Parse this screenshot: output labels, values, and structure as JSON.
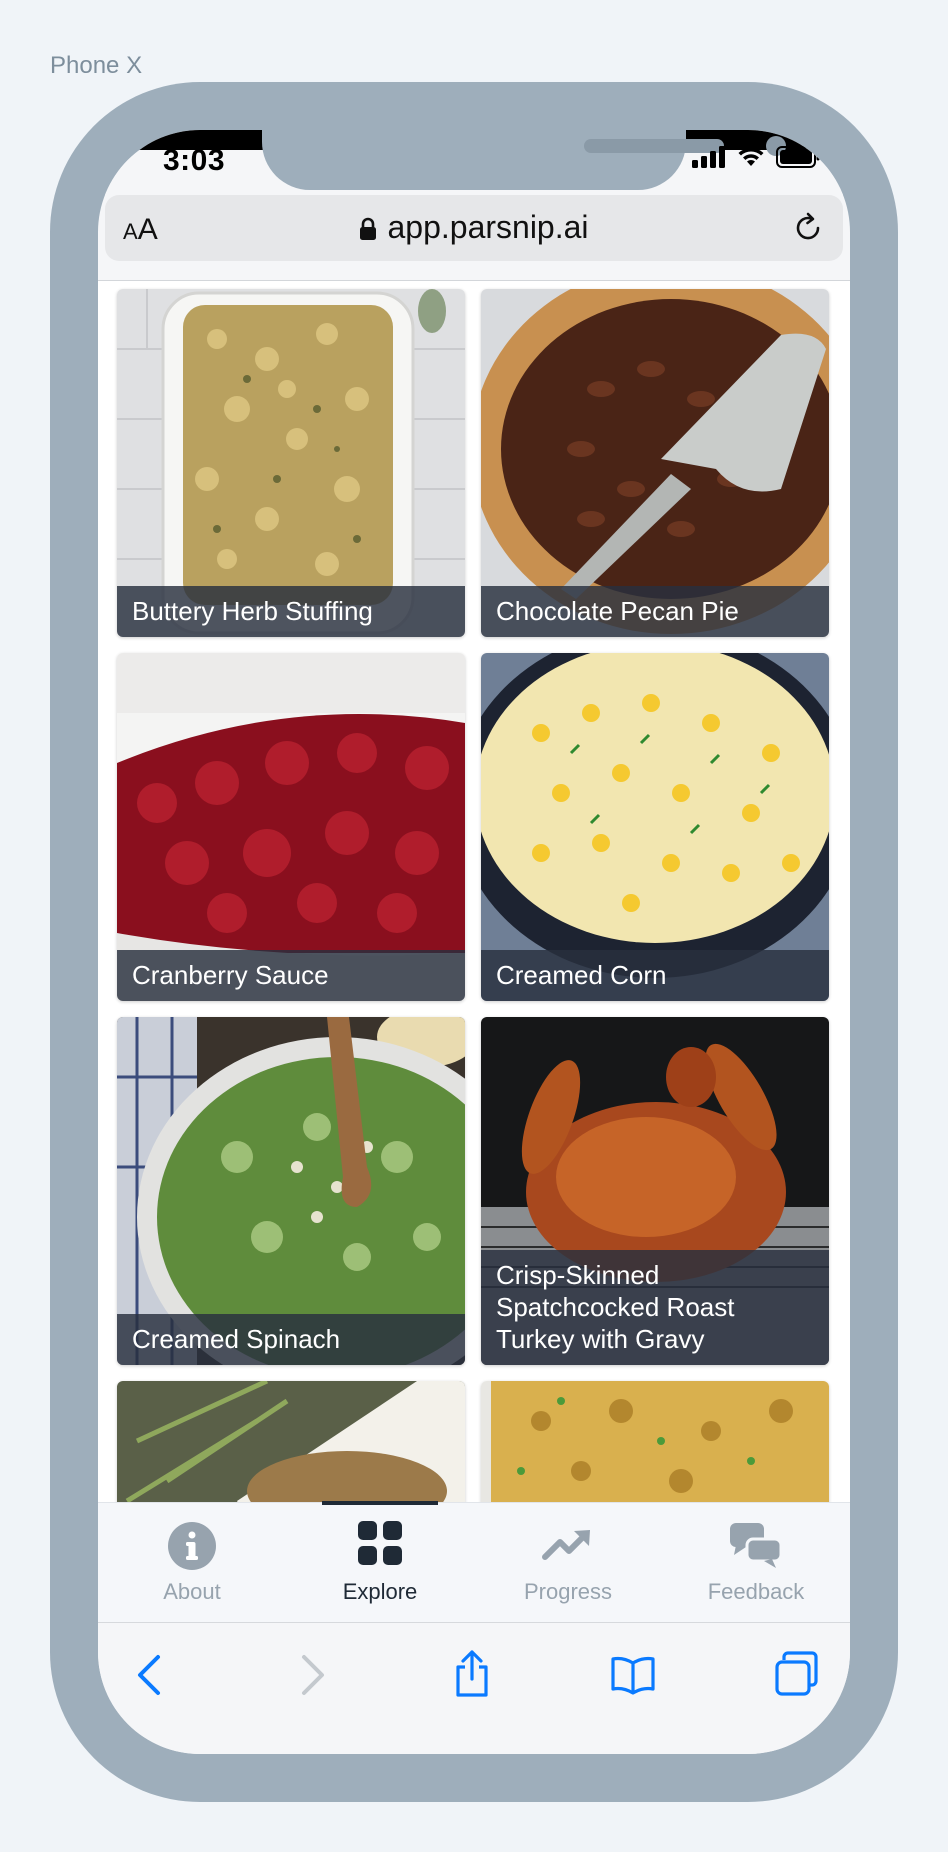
{
  "device_label": "Phone X",
  "status": {
    "time": "3:03"
  },
  "browser": {
    "url": "app.parsnip.ai",
    "text_size_button": "AA"
  },
  "recipes": [
    {
      "name": "Buttery Herb Stuffing"
    },
    {
      "name": "Chocolate Pecan Pie"
    },
    {
      "name": "Cranberry Sauce"
    },
    {
      "name": "Creamed Corn"
    },
    {
      "name": "Creamed Spinach"
    },
    {
      "name": "Crisp-Skinned Spatchcocked Roast Turkey with Gravy"
    },
    {
      "name": ""
    },
    {
      "name": ""
    }
  ],
  "tabs": [
    {
      "label": "About",
      "icon": "info-circle-icon"
    },
    {
      "label": "Explore",
      "icon": "grid-icon",
      "active": true
    },
    {
      "label": "Progress",
      "icon": "trending-up-icon"
    },
    {
      "label": "Feedback",
      "icon": "chat-bubbles-icon"
    }
  ],
  "colors": {
    "accent": "#0a7aff",
    "tab_active": "#1f2a36",
    "tab_inactive": "#97a3ae",
    "caption_bg": "#28303e"
  }
}
